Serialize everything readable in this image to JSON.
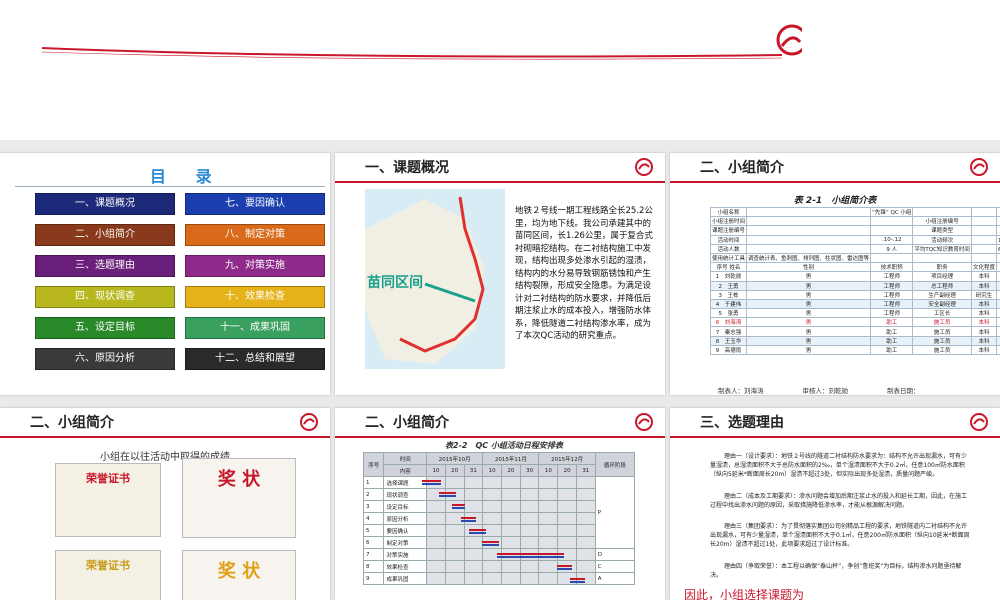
{
  "toc": {
    "title": "目 录",
    "items": [
      {
        "label": "一、课题概况",
        "color": "#1d2a7a"
      },
      {
        "label": "七、要因确认",
        "color": "#1b3fae"
      },
      {
        "label": "二、小组简介",
        "color": "#8a3a1c"
      },
      {
        "label": "八、制定对策",
        "color": "#d86a1a"
      },
      {
        "label": "三、选题理由",
        "color": "#6a1f7a"
      },
      {
        "label": "九、对策实施",
        "color": "#8e2a8a"
      },
      {
        "label": "四、现状调查",
        "color": "#b8b81e"
      },
      {
        "label": "十、效果检查",
        "color": "#e6b21a"
      },
      {
        "label": "五、设定目标",
        "color": "#2a8a2a"
      },
      {
        "label": "十一、成果巩固",
        "color": "#3aa060"
      },
      {
        "label": "六、原因分析",
        "color": "#3a3a3a"
      },
      {
        "label": "十二、总结和展望",
        "color": "#2a2a2a"
      }
    ]
  },
  "slide2": {
    "title": "一、课题概况",
    "map_label": "苗同区间",
    "body": "地铁２号线一期工程线路全长25.2公里，均为地下线。我公司承建其中的苗同区间，长1.26公里，属于复合式衬砌暗挖结构。在二衬结构施工中发现，结构出现多处渗水引起的湿渍，结构内的水分易导致钢筋锈蚀和产生结构裂隙，形成安全隐患。为满足设计对二衬结构的防水要求，并降低后期注浆止水的成本投入，增强防水体系，降低隧道二衬结构渗水率，成为了本次QC活动的研究重点。"
  },
  "slide3": {
    "title": "二、小组简介",
    "caption": "表 2-1　小组简介表",
    "rows": [
      [
        "小组名称",
        "",
        "“先锋” QC 小组",
        "",
        "",
        "",
        ""
      ],
      [
        "小组注册时间",
        "",
        "",
        "小组注册编号",
        "",
        "",
        ""
      ],
      [
        "课题注册编号",
        "",
        "",
        "课题类型",
        "",
        "现场型",
        ""
      ],
      [
        "活动时间",
        "",
        ".10-.12",
        "活动频次",
        "",
        "1次 / 周",
        ""
      ],
      [
        "活动人数",
        "",
        "9 人",
        "平均TQC知识教育时间",
        "",
        "60 课时",
        ""
      ],
      [
        "使用统计工具",
        "调查统计表、鱼刺图、排列图、柱状图、雷达图等",
        "",
        "",
        "",
        "",
        ""
      ],
      [
        "序号 姓名",
        "性别",
        "技术职称",
        "职务",
        "文化程度",
        "年龄",
        "组内分工"
      ],
      [
        "1　刘乾勋",
        "男",
        "工程师",
        "项目经理",
        "本科",
        "38",
        "组长 负责课题策划"
      ],
      [
        "2　王勇",
        "男",
        "工程师",
        "总工程师",
        "本科",
        "28",
        "副组长 负责调查实施"
      ],
      [
        "3　王栋",
        "男",
        "工程师",
        "生产副经理",
        "研究生",
        "29",
        "调查实施、数据统计"
      ],
      [
        "4　于建伟",
        "男",
        "工程师",
        "安全副经理",
        "本科",
        "29",
        "调查实施"
      ],
      [
        "5　张勇",
        "男",
        "工程师",
        "工区长",
        "本科",
        "29",
        "调查实施"
      ],
      [
        "6　刘海涛",
        "男",
        "助工",
        "施工员",
        "本科",
        "27",
        "资料收集、成果发布"
      ],
      [
        "7　秦志强",
        "男",
        "助工",
        "施工员",
        "本科",
        "28",
        "调查实施"
      ],
      [
        "8　王玉华",
        "男",
        "助工",
        "施工员",
        "本科",
        "28",
        "调查实施"
      ],
      [
        "9　高德雨",
        "男",
        "助工",
        "施工员",
        "本科",
        "28",
        "调查实施"
      ]
    ],
    "footer": "制表人：刘海涛　　　　　　审核人：刘乾勋　　　　　　制表日期："
  },
  "slide4": {
    "title": "二、小组简介",
    "subtitle": "小组在以往活动中取得的成绩",
    "certs": [
      {
        "head": "荣誉证书",
        "color": "#c8172a"
      },
      {
        "head": "奖 状",
        "color": "#c8172a"
      },
      {
        "head": "荣誉证书",
        "color": "#c8172a"
      },
      {
        "head": "奖 状",
        "color": "#c8172a"
      }
    ]
  },
  "slide5": {
    "title": "二、小组简介",
    "caption": "表2-2　QC 小组活动日程安排表",
    "header_time": "时间",
    "header_seq": "序号",
    "header_content": "内容",
    "header_phase": "循环阶段",
    "months": [
      "2015年10月",
      "2015年11月",
      "2015年12月"
    ],
    "days": [
      "10",
      "20",
      "31",
      "10",
      "20",
      "30",
      "10",
      "20",
      "31"
    ],
    "rows": [
      "选择课题",
      "现状调查",
      "设定目标",
      "原因分析",
      "要因确认",
      "制定对策",
      "对策实施",
      "效果检查",
      "成果巩固"
    ],
    "phases": [
      "P",
      "D",
      "C",
      "A"
    ]
  },
  "slide6": {
    "title": "三、选题理由",
    "paras": [
      "理由一（设计要求）：地铁２号线的隧道二衬结构防水要求为：结构不允许出现漏水，可有少量湿渍，总湿渍面积不大于总防水面积的2‰，单个湿渍面积不大于0.2㎡，任意100㎡防水面积（纵向5延米*断面周长20m）湿渍不超过3处，但实际出现多处湿渍，质量问题严峻。",
      "理由二（成本及工期要求）：渗水问题会增加后期注浆止水的投入和延长工期，因此，在施工过程中找出渗水问题的原因，采取措施降低渗水率，才能从根源解决问题。",
      "理由三（集团要求）：为了贯彻落实集团公司创精品工程的要求，地铁隧道内二衬结构不允许出现漏水，可有少量湿渍，单个湿渍面积不大于0.1㎡，任意200㎡防水面积（纵向10延米*断面周长20m）湿渍不超过1处，此项要求超过了设计标准。",
      "理由四（争取荣誉）：本工程以确保“泰山杯”，争创“鲁班奖”为目标，结构渗水问题亟待解决。"
    ],
    "conclusion": "因此，小组选择课题为"
  }
}
